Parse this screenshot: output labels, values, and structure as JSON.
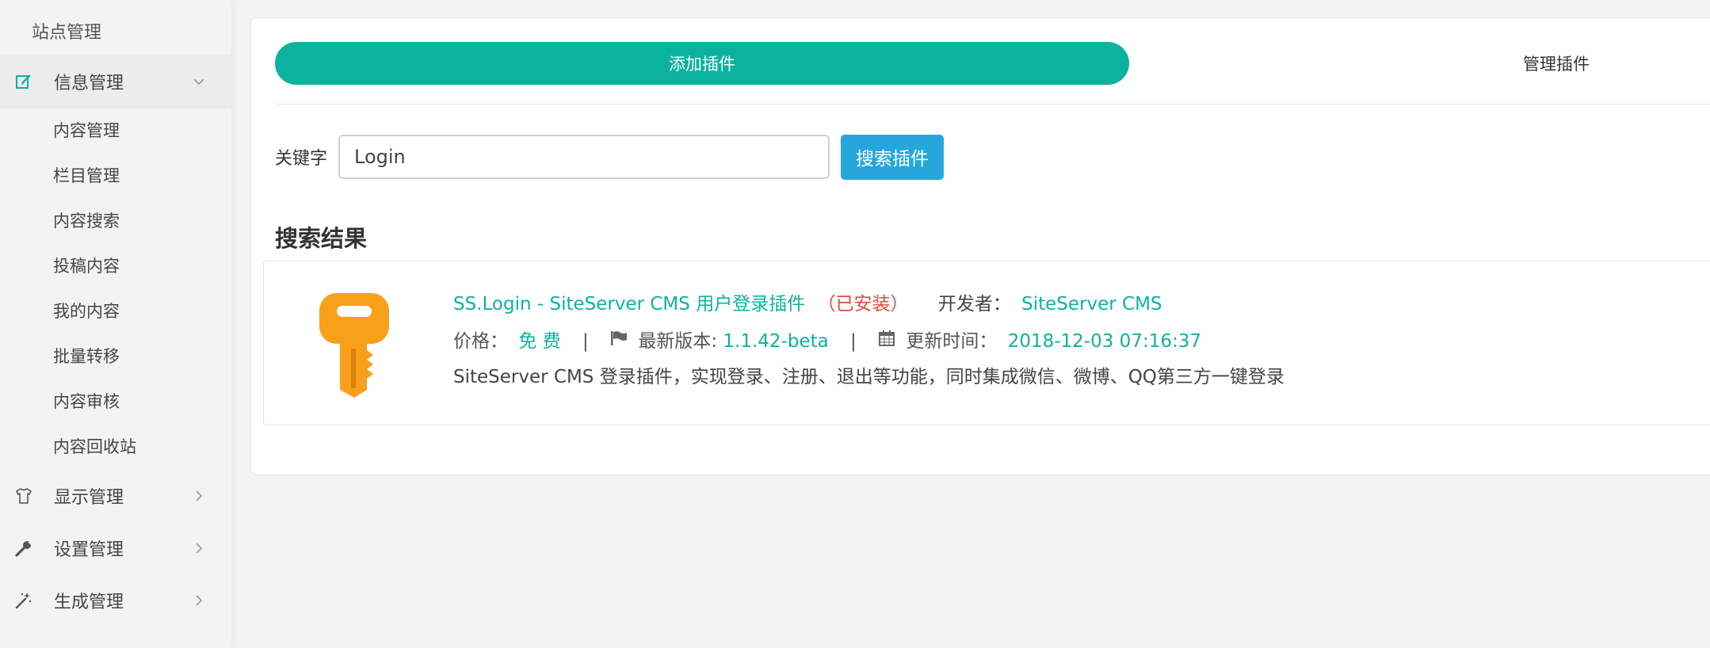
{
  "sidebar": {
    "site_title": "站点管理",
    "groups": [
      {
        "label": "信息管理",
        "icon": "edit-icon",
        "expanded": true,
        "items": [
          "内容管理",
          "栏目管理",
          "内容搜索",
          "投稿内容",
          "我的内容",
          "批量转移",
          "内容审核",
          "内容回收站"
        ]
      },
      {
        "label": "显示管理",
        "icon": "tshirt-icon",
        "expanded": false
      },
      {
        "label": "设置管理",
        "icon": "wrench-icon",
        "expanded": false
      },
      {
        "label": "生成管理",
        "icon": "magic-wand-icon",
        "expanded": false
      }
    ]
  },
  "tabs": {
    "add_label": "添加插件",
    "manage_label": "管理插件"
  },
  "search": {
    "keyword_label": "关键字",
    "value": "Login",
    "button_label": "搜索插件"
  },
  "results": {
    "title": "搜索结果",
    "items": [
      {
        "icon": "key-icon",
        "name": "SS.Login - SiteServer CMS 用户登录插件",
        "status": "（已安装）",
        "developer_label": "开发者：",
        "developer": "SiteServer CMS",
        "price_label": "价格：",
        "price": "免 费",
        "separator": "|",
        "version_label": "最新版本: ",
        "version": "1.1.42-beta",
        "updated_label": "更新时间：",
        "updated": "2018-12-03 07:16:37",
        "description": "SiteServer CMS 登录插件，实现登录、注册、退出等功能，同时集成微信、微博、QQ第三方一键登录"
      }
    ]
  },
  "colors": {
    "accent": "#0bb39e",
    "button_blue": "#26a7dc",
    "installed_red": "#e04a3f",
    "key_orange": "#f7a11a"
  }
}
